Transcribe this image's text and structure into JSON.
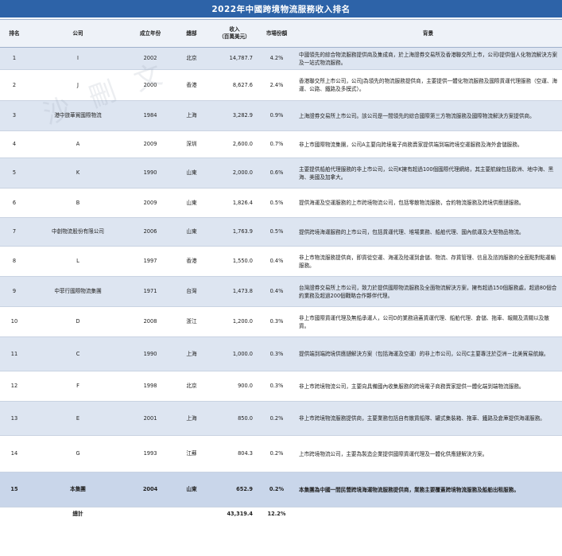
{
  "chart_data": {
    "type": "table",
    "title": "2022年中國跨境物流服務收入排名",
    "columns": [
      "排名",
      "公司",
      "成立年份",
      "總部",
      "收入\n（百萬美元）",
      "市場份額",
      "背景"
    ],
    "rows": [
      {
        "rank": "1",
        "company": "I",
        "year": "2002",
        "hq": "北京",
        "revenue": "14,787.7",
        "share": "4.2%",
        "background": "中國領先的綜合物流服務提供商及集成商，於上海證券交易所及香港聯交所上市，公司I提供個人化物流解決方案及一站式物流服務。"
      },
      {
        "rank": "2",
        "company": "J",
        "year": "2000",
        "hq": "香港",
        "revenue": "8,627.6",
        "share": "2.4%",
        "background": "香港聯交所上市公司，公司J為領先的物流服務提供商，主要提供一體化物流服務及國際貨運代理服務（空運、海運、公路、鐵路及多模式）。"
      },
      {
        "rank": "3",
        "company": "港中旅華貿國際物流",
        "year": "1984",
        "hq": "上海",
        "revenue": "3,282.9",
        "share": "0.9%",
        "background": "上海證券交易所上市公司。該公司是一間領先的綜合國際第三方物流服務及國際物流解決方案提供商。"
      },
      {
        "rank": "4",
        "company": "A",
        "year": "2009",
        "hq": "深圳",
        "revenue": "2,600.0",
        "share": "0.7%",
        "background": "非上市國際物流集團，公司A主要向跨境電子商務賣家提供端到端跨境空運服務及海外倉儲服務。"
      },
      {
        "rank": "5",
        "company": "K",
        "year": "1990",
        "hq": "山東",
        "revenue": "2,000.0",
        "share": "0.6%",
        "background": "主要提供船舶代理服務的非上市公司，公司K擁有超過100個國際代理網絡，其主要航線包括歐洲、地中海、黑海、美國及加拿大。"
      },
      {
        "rank": "6",
        "company": "B",
        "year": "2009",
        "hq": "山東",
        "revenue": "1,826.4",
        "share": "0.5%",
        "background": "提供海運及空運服務的上市跨境物流公司，包括零散物流服務，合約物流服務及跨境供應鏈服務。"
      },
      {
        "rank": "7",
        "company": "中創物流股份有限公司",
        "year": "2006",
        "hq": "山東",
        "revenue": "1,763.9",
        "share": "0.5%",
        "background": "提供跨境海運服務的上市公司，包括貨運代理、堆場業務、船舶代理、國內航運及大型物品物流。"
      },
      {
        "rank": "8",
        "company": "L",
        "year": "1997",
        "hq": "香港",
        "revenue": "1,550.0",
        "share": "0.4%",
        "background": "非上市物流服務提供商，即貨從空運、海運及陸運到倉儲、物流、存貨管理、信息及諮詢服務的全面點對點運輸服務。"
      },
      {
        "rank": "9",
        "company": "中菲行國際物流集團",
        "year": "1971",
        "hq": "台灣",
        "revenue": "1,473.8",
        "share": "0.4%",
        "background": "台灣證券交易所上市公司，致力於提供國際物流服務及全面物流解決方案，擁有超過150個服務處，超過80個合約業務及超過200個戰略合作夥伴代理。"
      },
      {
        "rank": "10",
        "company": "D",
        "year": "2008",
        "hq": "浙江",
        "revenue": "1,200.0",
        "share": "0.3%",
        "background": "非上市國際貨運代理及無船承運人，公司D的業務涵蓋貨運代理、船舶代理、倉儲、拖車、報關及清關以及散貨。"
      },
      {
        "rank": "11",
        "company": "C",
        "year": "1990",
        "hq": "上海",
        "revenue": "1,000.0",
        "share": "0.3%",
        "background": "提供端到端跨境供應鏈解決方案（包括海運及空運）的非上市公司，公司C主要專注於亞洲－北美貿易航線。"
      },
      {
        "rank": "12",
        "company": "F",
        "year": "1998",
        "hq": "北京",
        "revenue": "900.0",
        "share": "0.3%",
        "background": "非上市跨境物流公司，主要向具備國內收集服務的跨境電子商務賣家提供一體化端到端物流服務。"
      },
      {
        "rank": "13",
        "company": "E",
        "year": "2001",
        "hq": "上海",
        "revenue": "850.0",
        "share": "0.2%",
        "background": "非上市跨境物流服務提供商，主要業務包括自有散貨船隊、罐式集裝箱、拖車、鐵路及倉庫提供海運服務。"
      },
      {
        "rank": "14",
        "company": "G",
        "year": "1993",
        "hq": "江蘇",
        "revenue": "804.3",
        "share": "0.2%",
        "background": "上市跨境物流公司，主要為製造企業提供國際貨運代理及一體化供應鏈解決方案。"
      },
      {
        "rank": "15",
        "company": "本集團",
        "year": "2004",
        "hq": "山東",
        "revenue": "652.9",
        "share": "0.2%",
        "background": "本集團為中國一間民營跨境海運物流服務提供商，業務主要覆蓋跨境物流服務及船舶出租服務。"
      }
    ],
    "total": {
      "label": "總計",
      "revenue": "43,319.4",
      "share": "12.2%"
    }
  },
  "watermark": "沙 刪 文"
}
